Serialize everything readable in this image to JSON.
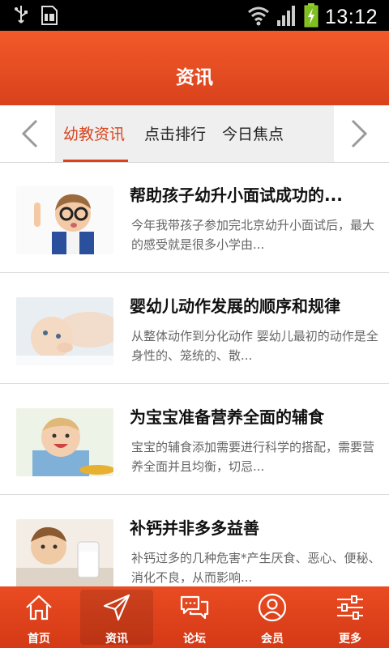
{
  "status_bar": {
    "time": "13:12",
    "icons": [
      "usb-icon",
      "sim-icon",
      "wifi-icon",
      "signal-icon",
      "battery-charging-icon"
    ]
  },
  "header": {
    "title": "资讯"
  },
  "tabs": [
    {
      "label": "幼教资讯",
      "active": true
    },
    {
      "label": "点击排行",
      "active": false
    },
    {
      "label": "今日焦点",
      "active": false
    }
  ],
  "articles": [
    {
      "title": "帮助孩子幼升小面试成功的...",
      "summary": "今年我带孩子参加完北京幼升小面试后，最大的感受就是很多小学由..."
    },
    {
      "title": "婴幼儿动作发展的顺序和规律",
      "summary": "从整体动作到分化动作 婴幼儿最初的动作是全身性的、笼统的、散..."
    },
    {
      "title": "为宝宝准备营养全面的辅食",
      "summary": "宝宝的辅食添加需要进行科学的搭配，需要营养全面并且均衡，切忌..."
    },
    {
      "title": "补钙并非多多益善",
      "summary": "补钙过多的几种危害*产生厌食、恶心、便秘、消化不良，从而影响..."
    }
  ],
  "bottom_nav": [
    {
      "label": "首页",
      "icon": "home-icon",
      "active": false
    },
    {
      "label": "资讯",
      "icon": "send-icon",
      "active": true
    },
    {
      "label": "论坛",
      "icon": "chat-icon",
      "active": false
    },
    {
      "label": "会员",
      "icon": "user-icon",
      "active": false
    },
    {
      "label": "更多",
      "icon": "sliders-icon",
      "active": false
    }
  ],
  "colors": {
    "accent": "#d9431b",
    "header": "#e64c22"
  }
}
